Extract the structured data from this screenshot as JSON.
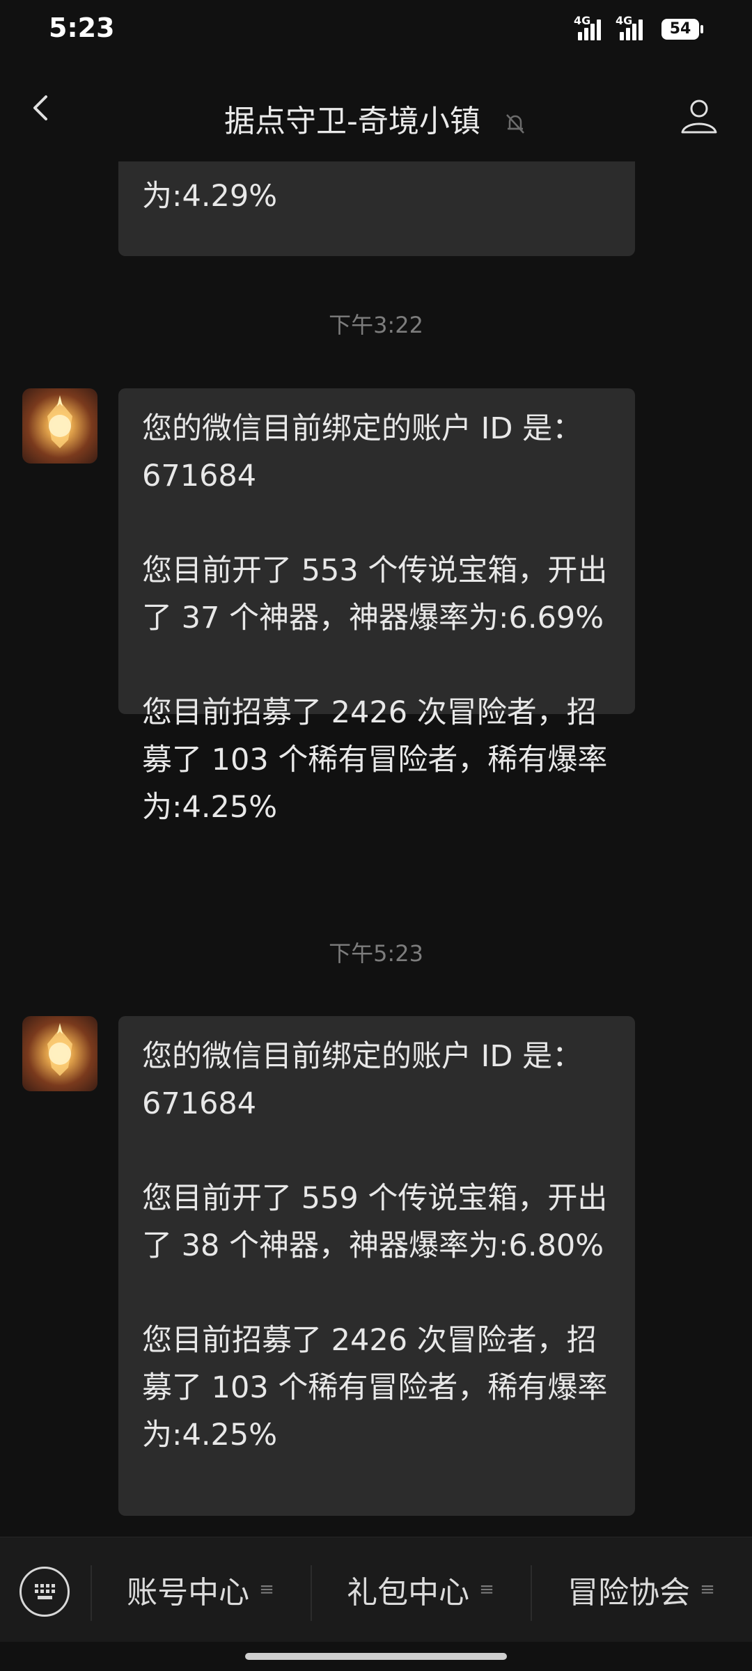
{
  "status_bar": {
    "time": "5:23",
    "network1": "4G",
    "network2": "4G",
    "battery": "54"
  },
  "header": {
    "title": "据点守卫-奇境小镇"
  },
  "messages": [
    {
      "text": "为:4.29%"
    },
    {
      "time": "下午3:22",
      "text": "您的微信目前绑定的账户 ID 是：\n671684\n\n您目前开了 553 个传说宝箱，开出了 37 个神器，神器爆率为:6.69%\n\n您目前招募了 2426 次冒险者，招募了 103 个稀有冒险者，稀有爆率为:4.25%"
    },
    {
      "time": "下午5:23",
      "text": "您的微信目前绑定的账户 ID 是：\n671684\n\n您目前开了 559 个传说宝箱，开出了 38 个神器，神器爆率为:6.80%\n\n您目前招募了 2426 次冒险者，招募了 103 个稀有冒险者，稀有爆率为:4.25%"
    }
  ],
  "bottom_menu": {
    "items": [
      "账号中心",
      "礼包中心",
      "冒险协会"
    ]
  }
}
